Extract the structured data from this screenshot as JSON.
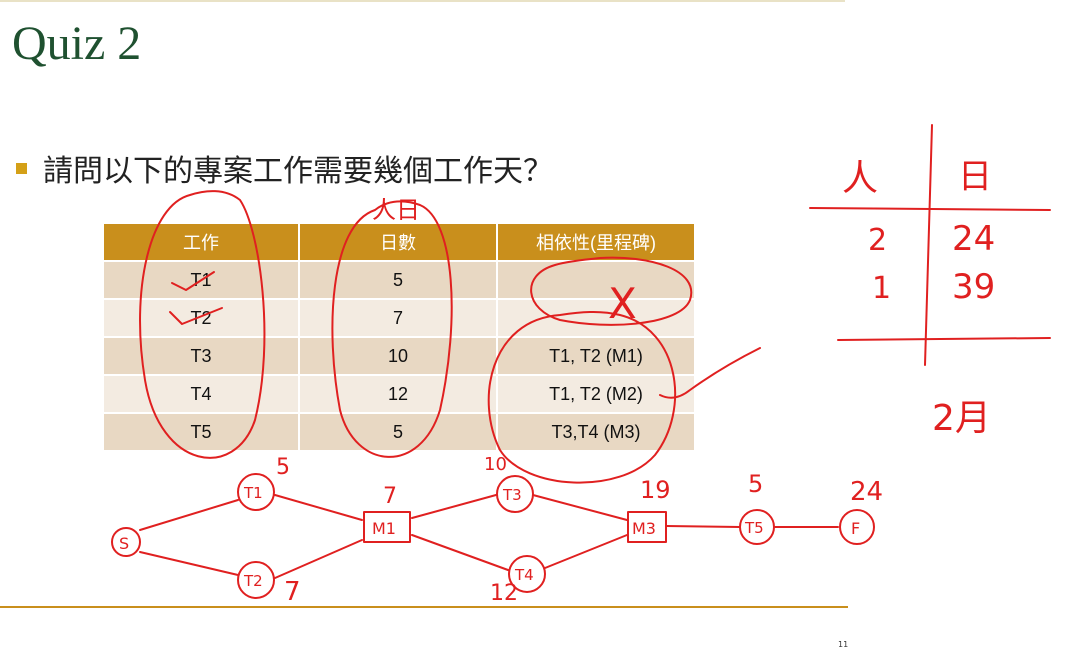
{
  "slide": {
    "title": "Quiz 2",
    "question": "請問以下的專案工作需要幾個工作天？",
    "page_number": "11"
  },
  "table": {
    "headers": [
      "工作",
      "日數",
      "相依性(里程碑)"
    ],
    "rows": [
      [
        "T1",
        "5",
        ""
      ],
      [
        "T2",
        "7",
        ""
      ],
      [
        "T3",
        "10",
        "T1, T2 (M1)"
      ],
      [
        "T4",
        "12",
        "T1, T2 (M2)"
      ],
      [
        "T5",
        "5",
        "T3,T4 (M3)"
      ]
    ]
  },
  "annotations": {
    "header_note": "人日",
    "side_table": {
      "headers": [
        "人",
        "日"
      ],
      "rows": [
        [
          "2",
          "24"
        ],
        [
          "1",
          "39"
        ]
      ],
      "footer": "2月"
    },
    "network": {
      "start": "S",
      "finish": "F",
      "t1": "T1",
      "t2": "T2",
      "t3": "T3",
      "t4": "T4",
      "t5": "T5",
      "m1": "M1",
      "m3": "M3",
      "t1_days": "5",
      "t2_days": "7",
      "m1_days": "7",
      "t3_days": "10",
      "t4_days": "12",
      "m3_days": "19",
      "t5_days": "5",
      "f_days": "24"
    },
    "cross_mark": "X"
  },
  "colors": {
    "title": "#1f5130",
    "accent": "#c98f1c",
    "bullet": "#d4a017",
    "ink": "#e02020",
    "row_odd": "#e8d8c3",
    "row_even": "#f3ebe1"
  }
}
